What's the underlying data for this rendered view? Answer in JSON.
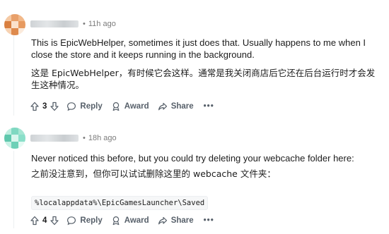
{
  "comments": [
    {
      "meta": {
        "separator": "•",
        "timestamp": "11h ago"
      },
      "body": {
        "en": "This is EpicWebHelper, sometimes it just does that. Usually happens to me when I close the store and it keeps running in the background.",
        "zh": "这是 EpicWebHelper，有时候它会这样。通常是我关闭商店后它还在后台运行时才会发生这种情况。"
      },
      "actions": {
        "upvote_icon": "arrow-up-icon",
        "vote_count": "3",
        "downvote_icon": "arrow-down-icon",
        "reply_label": "Reply",
        "award_label": "Award",
        "share_label": "Share",
        "more_label": "•••"
      },
      "avatar": {
        "colors": [
          "#f5c9a4",
          "#e8a06a",
          "#f2b98a",
          "#d97f3f",
          "#fbe1cb",
          "#e79a60",
          "#f7d2b2",
          "#de8a4d",
          "#fbeadb"
        ]
      }
    },
    {
      "meta": {
        "separator": "•",
        "timestamp": "18h ago"
      },
      "body": {
        "en": "Never noticed this before, but you could try deleting your webcache folder here:",
        "zh": "之前没注意到，但你可以试试删除这里的 webcache 文件夹：",
        "code": "%localappdata%\\EpicGamesLauncher\\Saved"
      },
      "actions": {
        "upvote_icon": "arrow-up-icon",
        "vote_count": "4",
        "downvote_icon": "arrow-down-icon",
        "reply_label": "Reply",
        "award_label": "Award",
        "share_label": "Share",
        "more_label": "•••"
      },
      "avatar": {
        "colors": [
          "#bfeee0",
          "#7fd8c1",
          "#a6e6d3",
          "#5fc8ad",
          "#d9f6ed",
          "#8adfc9",
          "#c8f1e5",
          "#6ed0b7",
          "#e6faf4"
        ]
      }
    }
  ]
}
